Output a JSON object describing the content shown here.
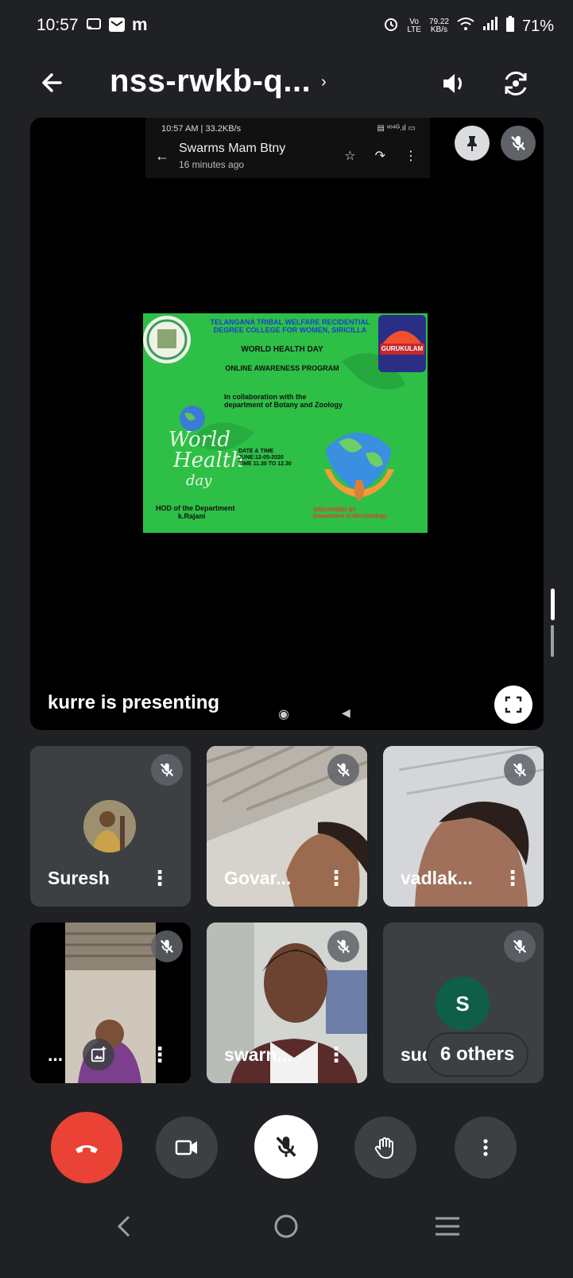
{
  "status_bar": {
    "time": "10:57",
    "left_icons": [
      "cast-icon",
      "mail-icon"
    ],
    "carrier_glyph": "m",
    "net_top": "79.22",
    "net_bottom": "KB/s",
    "lte_top": "Vo",
    "lte_bottom": "LTE",
    "battery": "71%"
  },
  "header": {
    "title": "nss-rwkb-q...",
    "caret": "›"
  },
  "presentation": {
    "shared_phone": {
      "status_left": "10:57 AM | 33.2KB/s",
      "status_right": "▤ ᵛᵒ⁴ᴳ.ıl ▭",
      "sender": "Swarms Mam Btny",
      "time_ago": "16 minutes ago"
    },
    "poster": {
      "line1": "TELANGANA TRIBAL WELFARE RECIDENTIAL DEGREE COLLEGE FOR WOMEN, SIRICILLA",
      "line2": "WORLD HEALTH DAY",
      "line3": "ONLINE AWARENESS PROGRAM",
      "line4": "In collaboration with the department of Botany and Zoology",
      "script_world": "World",
      "script_health": "Health",
      "script_day": "day",
      "date_label": "DATE & TIME",
      "date_value": "JUNE:12-05-2020",
      "time_value": "TIME 11.30 TO 12.30",
      "hod_label": "HOD of the Department",
      "hod_name": "k.Rajani",
      "organised_label": "ORGANISED BY",
      "organised_dept": "Department of Microbiology",
      "gurukulam": "GURUKULAM"
    },
    "presenting_text": "kurre is presenting"
  },
  "participants": [
    {
      "name": "Suresh",
      "kind": "avatar"
    },
    {
      "name": "Govar...",
      "kind": "video"
    },
    {
      "name": "vadlak...",
      "kind": "video"
    },
    {
      "name": "...",
      "kind": "video"
    },
    {
      "name": "swarn...",
      "kind": "video"
    },
    {
      "name": "sud",
      "kind": "others",
      "initial": "S",
      "others_label": "6 others"
    }
  ],
  "controls": [
    "end-call",
    "camera",
    "microphone",
    "raise-hand",
    "more-options"
  ],
  "colors": {
    "background": "#202124",
    "tile": "#3c4043",
    "end_call": "#ea4335",
    "poster_green": "#2ebf47",
    "avatar_teal": "#0f5e4a"
  }
}
